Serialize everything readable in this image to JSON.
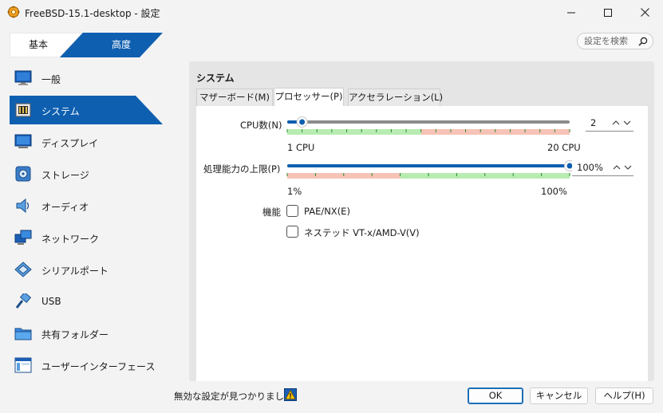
{
  "window": {
    "title": "FreeBSD-15.1-desktop - 設定"
  },
  "mode_tabs": {
    "basic": "基本",
    "advanced": "高度"
  },
  "search": {
    "placeholder": "設定を検索"
  },
  "sidebar": {
    "items": [
      {
        "label": "一般",
        "icon": "general-icon"
      },
      {
        "label": "システム",
        "icon": "system-icon"
      },
      {
        "label": "ディスプレイ",
        "icon": "display-icon"
      },
      {
        "label": "ストレージ",
        "icon": "storage-icon"
      },
      {
        "label": "オーディオ",
        "icon": "audio-icon"
      },
      {
        "label": "ネットワーク",
        "icon": "network-icon"
      },
      {
        "label": "シリアルポート",
        "icon": "serial-port-icon"
      },
      {
        "label": "USB",
        "icon": "usb-icon"
      },
      {
        "label": "共有フォルダー",
        "icon": "shared-folder-icon"
      },
      {
        "label": "ユーザーインターフェース",
        "icon": "user-interface-icon"
      }
    ],
    "active_index": 1
  },
  "section": {
    "title": "システム",
    "tabs": [
      {
        "label": "マザーボード(M)"
      },
      {
        "label": "プロセッサー(P)"
      },
      {
        "label": "アクセラレーション(L)"
      }
    ],
    "active_tab": 1
  },
  "processor": {
    "cpu_count": {
      "label": "CPU数(N)",
      "value": "2",
      "min": 1,
      "max": 20,
      "current": 2,
      "min_label": "1 CPU",
      "max_label": "20 CPU"
    },
    "exec_cap": {
      "label": "処理能力の上限(P)",
      "value": "100%",
      "min": 1,
      "max": 100,
      "current": 100,
      "min_label": "1%",
      "max_label": "100%"
    },
    "features": {
      "label": "機能",
      "pae": {
        "label": "PAE/NX(E)",
        "checked": false
      },
      "nested_vtx": {
        "label": "ネステッド VT-x/AMD-V(V)",
        "checked": false
      }
    }
  },
  "footer": {
    "warning": "無効な設定が見つかりました",
    "ok": "OK",
    "cancel": "キャンセル",
    "help": "ヘルプ(H)"
  },
  "colors": {
    "accent": "#0f5fb0",
    "safe": "#b8ecb2",
    "danger": "#f6c3b7",
    "tick": "#2e8a2e"
  }
}
